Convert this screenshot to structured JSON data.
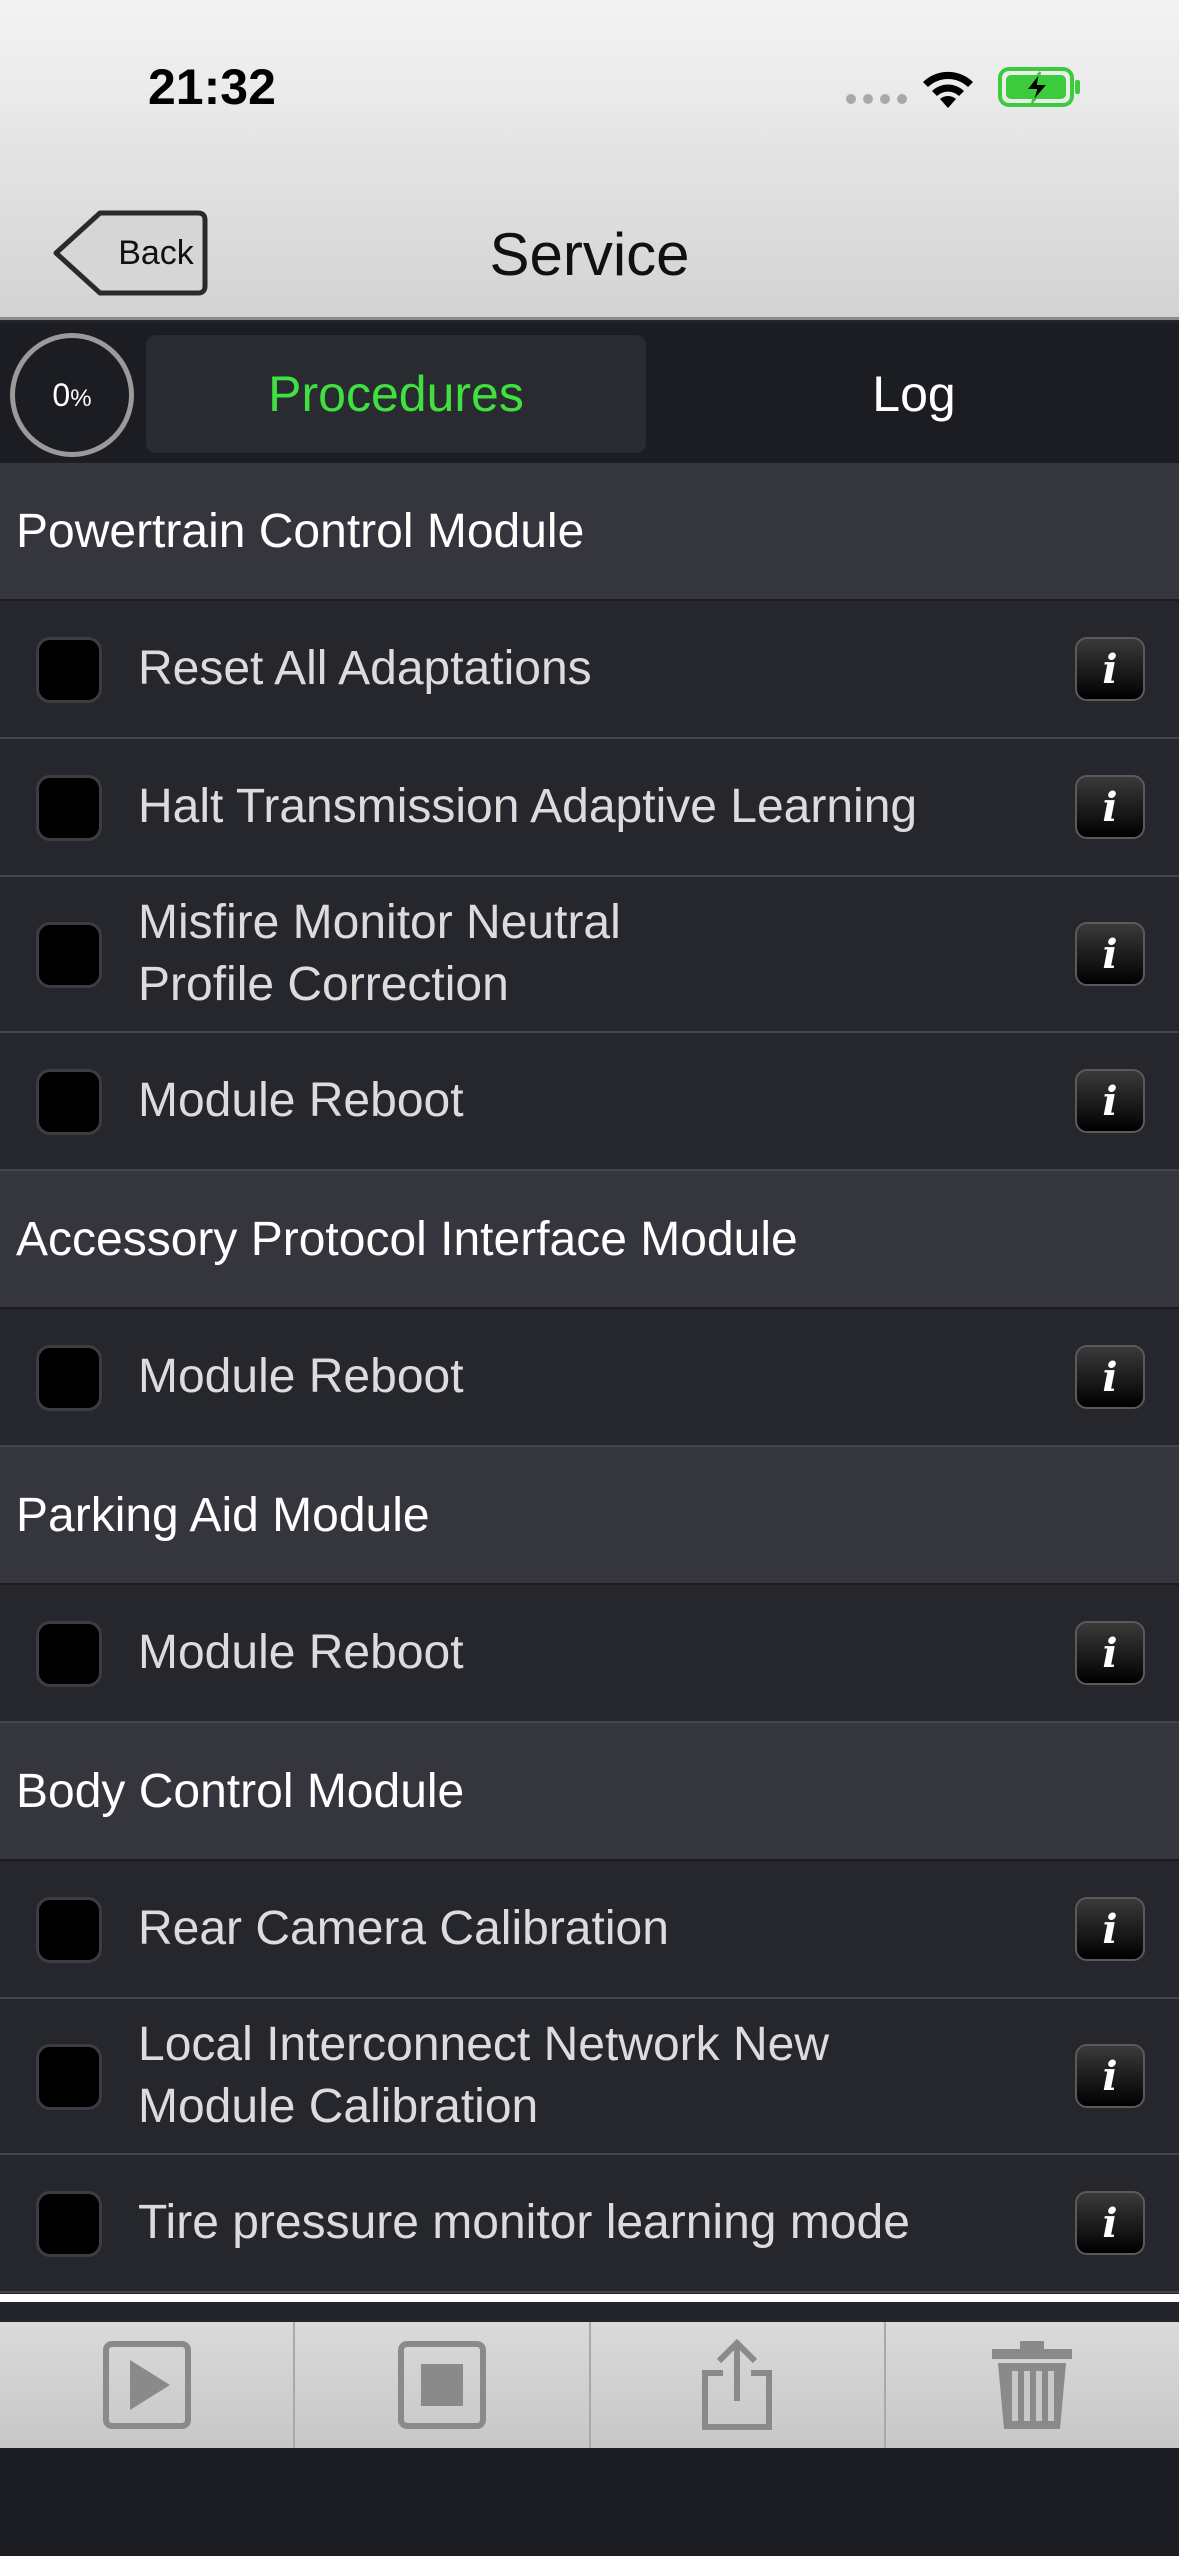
{
  "status_bar": {
    "time": "21:32"
  },
  "nav": {
    "back_label": "Back",
    "title": "Service"
  },
  "segment": {
    "progress_value": "0",
    "progress_unit": "%",
    "tabs": [
      {
        "label": "Procedures",
        "selected": true
      },
      {
        "label": "Log",
        "selected": false
      }
    ]
  },
  "sections": [
    {
      "title": "Powertrain Control Module",
      "items": [
        {
          "label": "Reset All Adaptations"
        },
        {
          "label": "Halt Transmission Adaptive Learning"
        },
        {
          "label": "Misfire Monitor Neutral Profile Correction"
        },
        {
          "label": "Module Reboot"
        }
      ]
    },
    {
      "title": "Accessory Protocol Interface Module",
      "items": [
        {
          "label": "Module Reboot"
        }
      ]
    },
    {
      "title": "Parking Aid Module",
      "items": [
        {
          "label": "Module Reboot"
        }
      ]
    },
    {
      "title": "Body Control Module",
      "items": [
        {
          "label": "Rear Camera Calibration"
        },
        {
          "label": "Local Interconnect Network New Module Calibration"
        },
        {
          "label": "Tire pressure monitor learning mode"
        }
      ]
    }
  ],
  "info_glyph": "i",
  "toolbar": {
    "icons": [
      "play-icon",
      "stop-icon",
      "share-icon",
      "trash-icon"
    ]
  },
  "colors": {
    "accent_green": "#3fe03f",
    "battery_green": "#3ccb3c"
  }
}
